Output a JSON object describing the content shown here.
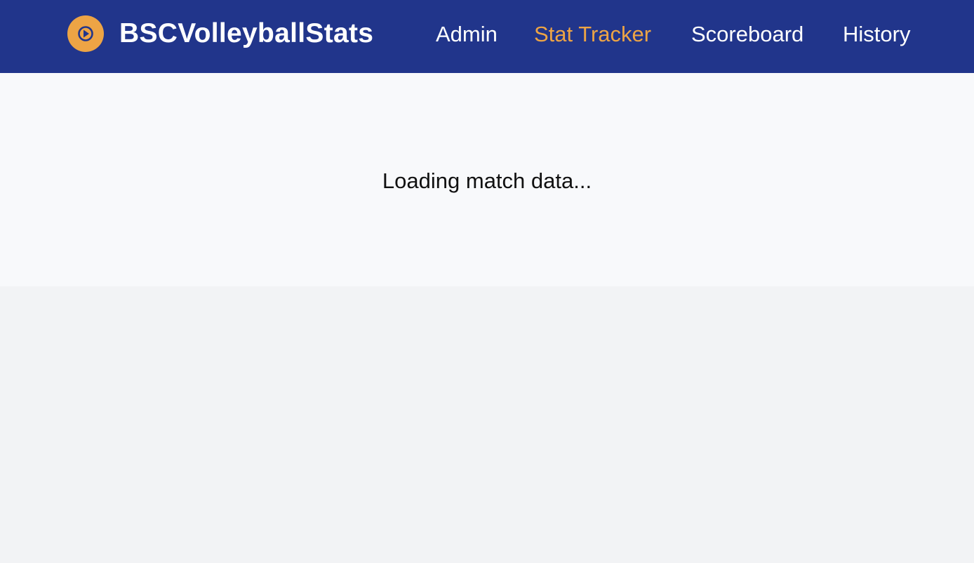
{
  "colors": {
    "header_background": "#21358b",
    "accent": "#eda445",
    "nav_text": "#ffffff",
    "panel_background": "#f8f9fb",
    "page_background": "#f2f3f5"
  },
  "header": {
    "logo_icon": "play-circle-icon",
    "app_title": "BSCVolleyballStats"
  },
  "nav": {
    "items": [
      {
        "label": "Admin",
        "active": false
      },
      {
        "label": "Stat Tracker",
        "active": true
      },
      {
        "label": "Scoreboard",
        "active": false
      },
      {
        "label": "History",
        "active": false
      }
    ]
  },
  "main": {
    "loading_message": "Loading match data..."
  }
}
